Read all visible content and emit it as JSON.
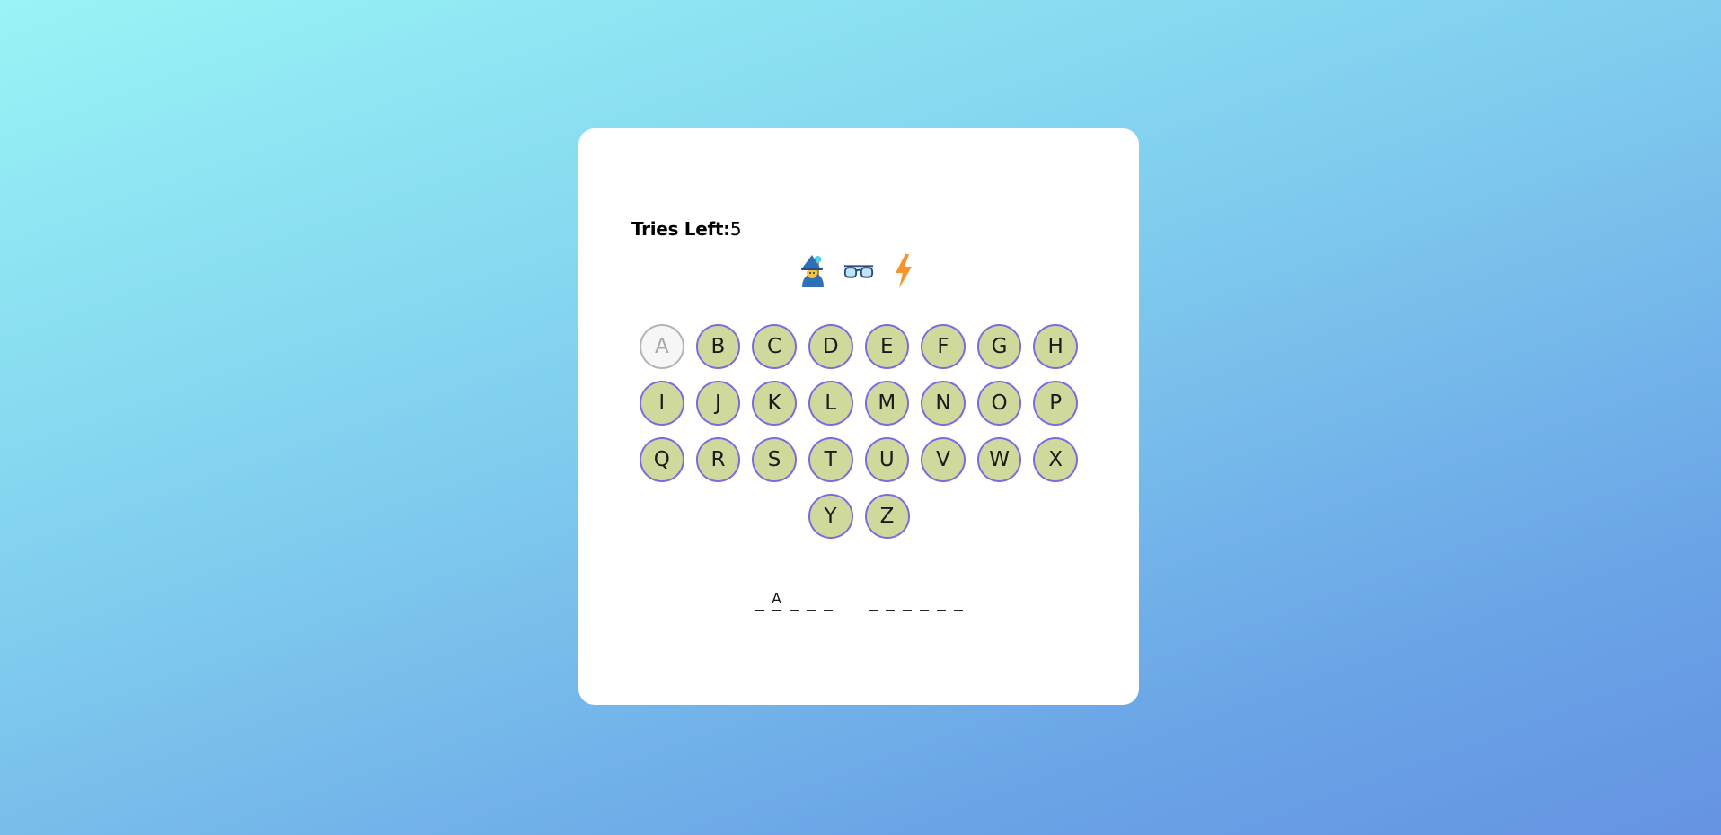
{
  "tries": {
    "label": "Tries Left:",
    "value": "5"
  },
  "hint": {
    "emojis": [
      {
        "name": "wizard-emoji-icon",
        "glyph": "🧙‍♀️"
      },
      {
        "name": "glasses-emoji-icon",
        "glyph": "👓"
      },
      {
        "name": "lightning-emoji-icon",
        "glyph": "⚡"
      }
    ]
  },
  "keyboard": {
    "rows": [
      [
        "A",
        "B",
        "C",
        "D",
        "E",
        "F",
        "G",
        "H"
      ],
      [
        "I",
        "J",
        "K",
        "L",
        "M",
        "N",
        "O",
        "P"
      ],
      [
        "Q",
        "R",
        "S",
        "T",
        "U",
        "V",
        "W",
        "X"
      ],
      [
        "Y",
        "Z"
      ]
    ],
    "used": [
      "A"
    ]
  },
  "word": {
    "groups": [
      [
        "",
        "A",
        "",
        "",
        ""
      ],
      [
        "",
        "",
        "",
        "",
        "",
        ""
      ]
    ]
  },
  "colors": {
    "key_fill": "#cfd99b",
    "key_border": "#7b6be0",
    "used_fill": "#f6f6f6",
    "used_border": "#b4b4b4"
  }
}
